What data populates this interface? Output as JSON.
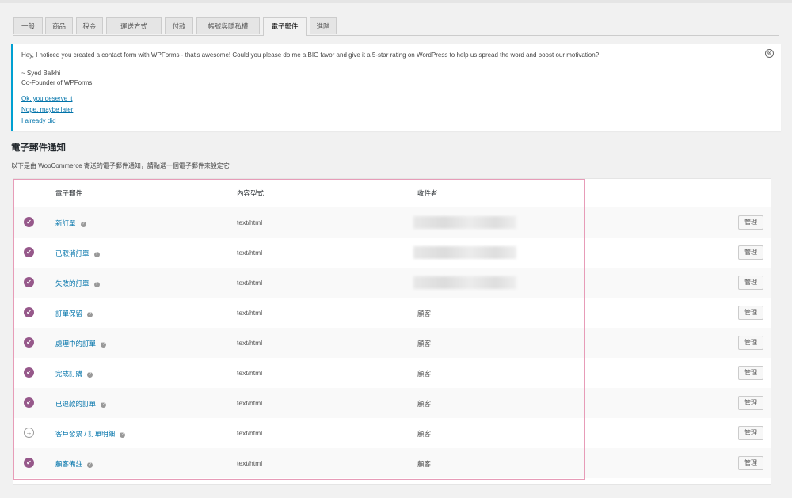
{
  "tabs": [
    "一般",
    "商品",
    "稅金",
    "運送方式",
    "付款",
    "帳號與隱私權",
    "電子郵件",
    "進階"
  ],
  "active_tab": "電子郵件",
  "notice": {
    "message": "Hey, I noticed you created a contact form with WPForms - that's awesome! Could you please do me a BIG favor and give it a 5-star rating on WordPress to help us spread the word and boost our motivation?",
    "signature_name": "~ Syed Balkhi",
    "signature_title": "Co-Founder of WPForms",
    "links": [
      "Ok, you deserve it",
      "Nope, maybe later",
      "I already did"
    ],
    "dismiss_icon": "⊗"
  },
  "section": {
    "title": "電子郵件通知",
    "description": "以下是由 WooCommerce 寄送的電子郵件通知，請點選一個電子郵件來設定它"
  },
  "table": {
    "headers": {
      "email": "電子郵件",
      "content_type": "內容型式",
      "recipient": "收件者"
    },
    "manage_label": "管理",
    "rows": [
      {
        "status": "enabled",
        "status_icon": "✔",
        "name": "新訂單",
        "content_type": "text/html",
        "recipient": "",
        "recipient_blurred": true
      },
      {
        "status": "enabled",
        "status_icon": "✔",
        "name": "已取消訂單",
        "content_type": "text/html",
        "recipient": "",
        "recipient_blurred": true
      },
      {
        "status": "enabled",
        "status_icon": "✔",
        "name": "失敗的訂單",
        "content_type": "text/html",
        "recipient": "",
        "recipient_blurred": true
      },
      {
        "status": "enabled",
        "status_icon": "✔",
        "name": "訂單保留",
        "content_type": "text/html",
        "recipient": "顧客",
        "recipient_blurred": false
      },
      {
        "status": "enabled",
        "status_icon": "✔",
        "name": "處理中的訂單",
        "content_type": "text/html",
        "recipient": "顧客",
        "recipient_blurred": false
      },
      {
        "status": "enabled",
        "status_icon": "✔",
        "name": "完成訂購",
        "content_type": "text/html",
        "recipient": "顧客",
        "recipient_blurred": false
      },
      {
        "status": "enabled",
        "status_icon": "✔",
        "name": "已退款的訂單",
        "content_type": "text/html",
        "recipient": "顧客",
        "recipient_blurred": false
      },
      {
        "status": "manual",
        "status_icon": "→",
        "name": "客戶發票 / 訂單明細",
        "content_type": "text/html",
        "recipient": "顧客",
        "recipient_blurred": false
      },
      {
        "status": "enabled",
        "status_icon": "✔",
        "name": "顧客備註",
        "content_type": "text/html",
        "recipient": "顧客",
        "recipient_blurred": false
      }
    ]
  },
  "colors": {
    "accent_link": "#0073aa",
    "woo_purple": "#96588a",
    "notice_border": "#00a0d2",
    "highlight_border": "#e79cb8"
  }
}
